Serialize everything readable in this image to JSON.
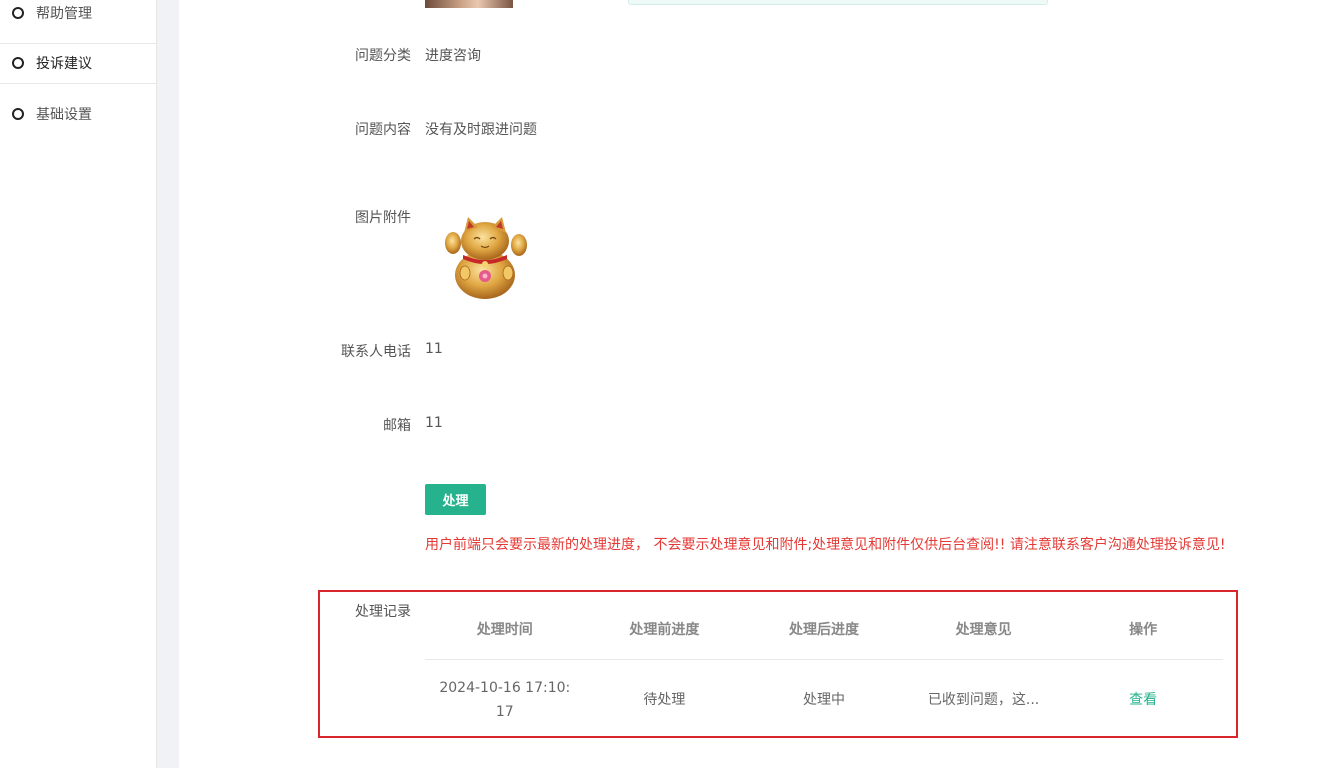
{
  "sidebar": {
    "items": [
      {
        "label": "帮助管理"
      },
      {
        "label": "投诉建议"
      },
      {
        "label": "基础设置"
      }
    ]
  },
  "details": {
    "category_label": "问题分类",
    "category_value": "进度咨询",
    "content_label": "问题内容",
    "content_value": "没有及时跟进问题",
    "attachment_label": "图片附件",
    "phone_label": "联系人电话",
    "phone_value": "11",
    "email_label": "邮箱",
    "email_value": "11"
  },
  "actions": {
    "process_label": "处理"
  },
  "notice": "用户前端只会要示最新的处理进度， 不会要示处理意见和附件;处理意见和附件仅供后台查阅!! 请注意联系客户沟通处理投诉意见!",
  "records": {
    "label": "处理记录",
    "columns": [
      "处理时间",
      "处理前进度",
      "处理后进度",
      "处理意见",
      "操作"
    ],
    "rows": [
      {
        "time": "2024-10-16 17:10:17",
        "before": "待处理",
        "after": "处理中",
        "opinion": "已收到问题，这...",
        "action": "查看"
      }
    ]
  },
  "colors": {
    "accent": "#25b28c",
    "warning": "#e53935",
    "highlight_border": "#d9262c"
  }
}
